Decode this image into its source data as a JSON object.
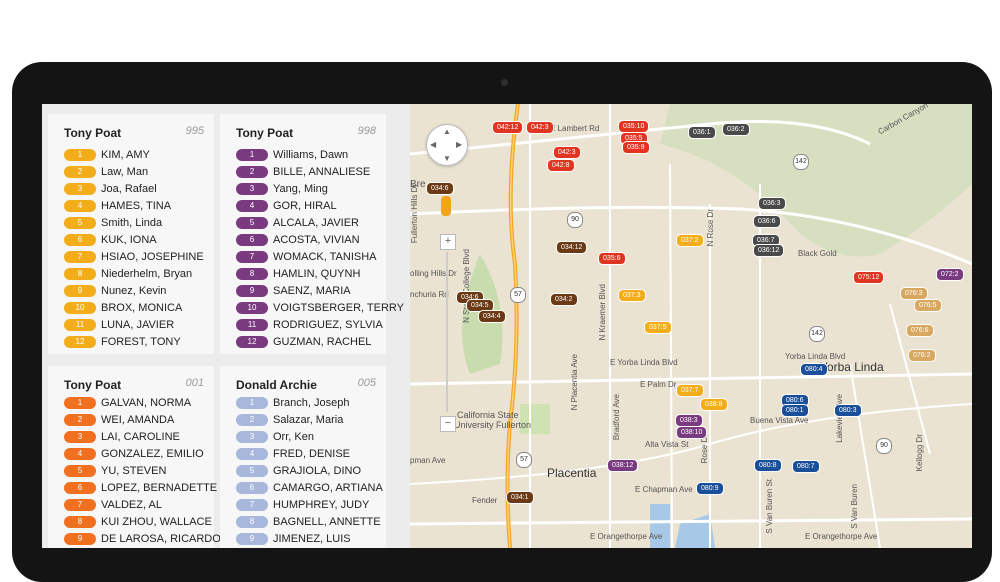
{
  "panel": {
    "cards": [
      {
        "name": "Tony Poat",
        "count": "995",
        "color": "#f3ad1a",
        "rows": [
          {
            "num": "1",
            "name": "KIM, AMY"
          },
          {
            "num": "2",
            "name": "Law, Man"
          },
          {
            "num": "3",
            "name": "Joa, Rafael"
          },
          {
            "num": "4",
            "name": "HAMES, TINA"
          },
          {
            "num": "5",
            "name": "Smith, Linda"
          },
          {
            "num": "6",
            "name": "KUK, IONA"
          },
          {
            "num": "7",
            "name": "HSIAO, JOSEPHINE"
          },
          {
            "num": "8",
            "name": "Niederhelm, Bryan"
          },
          {
            "num": "9",
            "name": "Nunez, Kevin"
          },
          {
            "num": "10",
            "name": "BROX, MONICA"
          },
          {
            "num": "11",
            "name": "LUNA, JAVIER"
          },
          {
            "num": "12",
            "name": "FOREST, TONY"
          }
        ]
      },
      {
        "name": "Tony Poat",
        "count": "998",
        "color": "#7a3a80",
        "rows": [
          {
            "num": "1",
            "name": "Williams, Dawn"
          },
          {
            "num": "2",
            "name": "BILLE, ANNALIESE"
          },
          {
            "num": "3",
            "name": "Yang, Ming"
          },
          {
            "num": "4",
            "name": "GOR, HIRAL"
          },
          {
            "num": "5",
            "name": "ALCALA, JAVIER"
          },
          {
            "num": "6",
            "name": "ACOSTA, VIVIAN"
          },
          {
            "num": "7",
            "name": "WOMACK, TANISHA"
          },
          {
            "num": "8",
            "name": "HAMLIN, QUYNH"
          },
          {
            "num": "9",
            "name": "SAENZ, MARIA"
          },
          {
            "num": "10",
            "name": "VOIGTSBERGER, TERRY"
          },
          {
            "num": "11",
            "name": "RODRIGUEZ, SYLVIA"
          },
          {
            "num": "12",
            "name": "GUZMAN, RACHEL"
          }
        ]
      },
      {
        "name": "Tony Poat",
        "count": "001",
        "color": "#f07020",
        "rows": [
          {
            "num": "1",
            "name": "GALVAN, NORMA"
          },
          {
            "num": "2",
            "name": "WEI, AMANDA"
          },
          {
            "num": "3",
            "name": "LAI, CAROLINE"
          },
          {
            "num": "4",
            "name": "GONZALEZ, EMILIO"
          },
          {
            "num": "5",
            "name": "YU, STEVEN"
          },
          {
            "num": "6",
            "name": "LOPEZ, BERNADETTE"
          },
          {
            "num": "7",
            "name": "VALDEZ, AL"
          },
          {
            "num": "8",
            "name": "KUI ZHOU, WALLACE"
          },
          {
            "num": "9",
            "name": "DE LAROSA, RICARDO"
          }
        ]
      },
      {
        "name": "Donald Archie",
        "count": "005",
        "color": "#a8b8dc",
        "rows": [
          {
            "num": "1",
            "name": "Branch, Joseph"
          },
          {
            "num": "2",
            "name": "Salazar, Maria"
          },
          {
            "num": "3",
            "name": "Orr, Ken"
          },
          {
            "num": "4",
            "name": "FRED, DENISE"
          },
          {
            "num": "5",
            "name": "GRAJIOLA, DINO"
          },
          {
            "num": "6",
            "name": "CAMARGO, ARTIANA"
          },
          {
            "num": "7",
            "name": "HUMPHREY, JUDY"
          },
          {
            "num": "8",
            "name": "BAGNELL, ANNETTE"
          },
          {
            "num": "9",
            "name": "JIMENEZ, LUIS"
          }
        ]
      }
    ]
  },
  "map": {
    "labels": {
      "lambert": "E Lambert Rd",
      "carbon": "Carbon Canyon",
      "rose_dr": "N Rose Dr",
      "kraemer": "N Kraemer Blvd",
      "placentia_ave": "N Placentia Ave",
      "bradford": "Bradford Ave",
      "rose_dr2": "Rose Dr",
      "yorba": "E Yorba Linda Blvd",
      "yorba2": "Yorba Linda Blvd",
      "palm": "E Palm Dr",
      "buena": "Buena Vista Ave",
      "alta": "Alta Vista St",
      "chapman": "E Chapman Ave",
      "chapman_w": "pman Ave",
      "fender": "Fender",
      "orangethorpe": "E Orangethorpe Ave",
      "orangethorpe2": "E Orangethorpe Ave",
      "csuf1": "California State",
      "csuf2": "University Fullerton",
      "placentia": "Placentia",
      "yorba_city": "Yorba Linda",
      "black_gold": "Black Gold",
      "lakeview": "Lakeview Ave",
      "kellogg": "Kellogg Dr",
      "van_buren": "S Van Buren St",
      "van_buren2": "S Van Buren",
      "state_college": "N State College Blvd",
      "rolling_hills": "olling Hills Dr",
      "ranchuria": "nchuria Rd",
      "brea": "Bre",
      "fullerton_hills": "Fullerton Hills Dr"
    },
    "shields": [
      "90",
      "142",
      "90",
      "142",
      "57",
      "57"
    ],
    "markers": [
      "042:12",
      "042:3",
      "042:8",
      "035:10",
      "035:5",
      "035:9",
      "036:1",
      "036:2",
      "036:3",
      "036:6",
      "036:7",
      "036:12",
      "037:2",
      "037:3",
      "037:5",
      "037:7",
      "034:12",
      "034:6",
      "034:5",
      "034:4",
      "034:2",
      "034:1",
      "035:6",
      "038:3",
      "038:8",
      "038:10",
      "038:12",
      "075:12",
      "076:2",
      "076:3",
      "076:5",
      "076:6",
      "072:2",
      "080:4",
      "080:6",
      "080:1",
      "080:3",
      "080:8",
      "080:7",
      "080:9"
    ],
    "controls": {
      "zoom_in": "+",
      "zoom_out": "−"
    }
  }
}
